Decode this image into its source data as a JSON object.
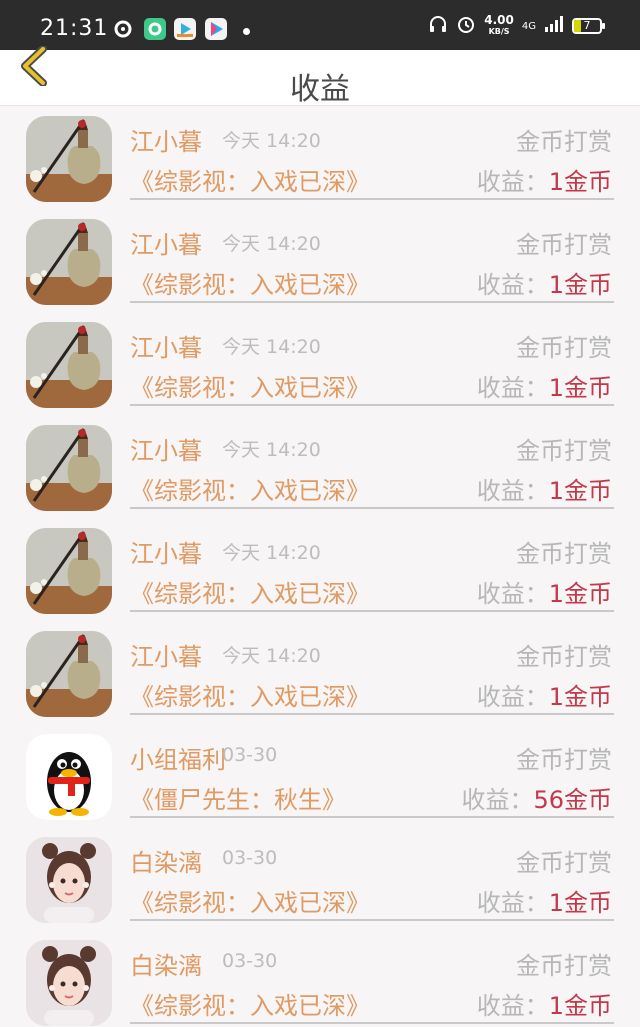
{
  "status_bar": {
    "time": "21:31",
    "net_speed": "4.00",
    "net_unit": "KB/S",
    "network": "4G",
    "battery": "7"
  },
  "header": {
    "title": "收益",
    "back_icon": "chevron-left-icon"
  },
  "colors": {
    "accent": "#e09a63",
    "amount": "#c23a49",
    "muted": "#b7b7b7",
    "back": "#e7c02b"
  },
  "rows": [
    {
      "name": "江小暮",
      "time": "今天 14:20",
      "tag": "金币打赏",
      "book": "《综影视：入戏已深》",
      "earn_label": "收益：",
      "amount": "1金币",
      "avatar": "vase"
    },
    {
      "name": "江小暮",
      "time": "今天 14:20",
      "tag": "金币打赏",
      "book": "《综影视：入戏已深》",
      "earn_label": "收益：",
      "amount": "1金币",
      "avatar": "vase"
    },
    {
      "name": "江小暮",
      "time": "今天 14:20",
      "tag": "金币打赏",
      "book": "《综影视：入戏已深》",
      "earn_label": "收益：",
      "amount": "1金币",
      "avatar": "vase"
    },
    {
      "name": "江小暮",
      "time": "今天 14:20",
      "tag": "金币打赏",
      "book": "《综影视：入戏已深》",
      "earn_label": "收益：",
      "amount": "1金币",
      "avatar": "vase"
    },
    {
      "name": "江小暮",
      "time": "今天 14:20",
      "tag": "金币打赏",
      "book": "《综影视：入戏已深》",
      "earn_label": "收益：",
      "amount": "1金币",
      "avatar": "vase"
    },
    {
      "name": "江小暮",
      "time": "今天 14:20",
      "tag": "金币打赏",
      "book": "《综影视：入戏已深》",
      "earn_label": "收益：",
      "amount": "1金币",
      "avatar": "vase"
    },
    {
      "name": "小组福利",
      "time": "03-30",
      "tag": "金币打赏",
      "book": "《僵尸先生：秋生》",
      "earn_label": "收益：",
      "amount": "56金币",
      "avatar": "penguin"
    },
    {
      "name": "白染漓",
      "time": "03-30",
      "tag": "金币打赏",
      "book": "《综影视：入戏已深》",
      "earn_label": "收益：",
      "amount": "1金币",
      "avatar": "girl"
    },
    {
      "name": "白染漓",
      "time": "03-30",
      "tag": "金币打赏",
      "book": "《综影视：入戏已深》",
      "earn_label": "收益：",
      "amount": "1金币",
      "avatar": "girl"
    }
  ]
}
